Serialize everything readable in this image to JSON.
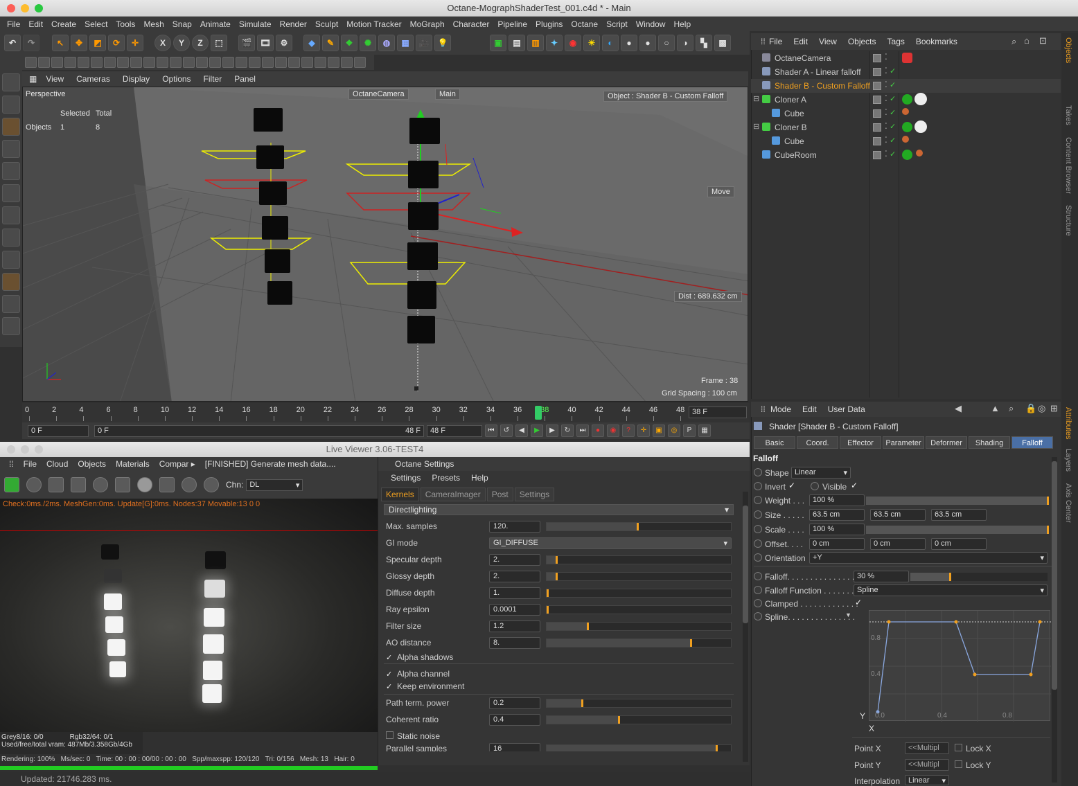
{
  "window": {
    "title": "Octane-MographShaderTest_001.c4d * - Main"
  },
  "menubar": [
    "File",
    "Edit",
    "Create",
    "Select",
    "Tools",
    "Mesh",
    "Snap",
    "Animate",
    "Simulate",
    "Render",
    "Sculpt",
    "Motion Tracker",
    "MoGraph",
    "Character",
    "Pipeline",
    "Plugins",
    "Octane",
    "Script",
    "Window",
    "Help"
  ],
  "toolbar": {
    "axis_x": "X",
    "axis_y": "Y",
    "axis_z": "Z"
  },
  "viewport": {
    "menu": [
      "View",
      "Cameras",
      "Display",
      "Options",
      "Filter",
      "Panel"
    ],
    "label": "Perspective",
    "selected_header": "Selected",
    "total_header": "Total",
    "objects_label": "Objects",
    "objects_selected": "1",
    "objects_total": "8",
    "camera_label": "OctaneCamera",
    "main_label": "Main",
    "object_info": "Object : Shader B - Custom Falloff",
    "move_label": "Move",
    "dist_label": "Dist : 689.632 cm",
    "frame_label": "Frame : 38",
    "grid_label": "Grid Spacing : 100 cm"
  },
  "timeline": {
    "ticks": [
      "0",
      "2",
      "4",
      "6",
      "8",
      "10",
      "12",
      "14",
      "16",
      "18",
      "20",
      "22",
      "24",
      "26",
      "28",
      "30",
      "32",
      "34",
      "36",
      "38",
      "40",
      "42",
      "44",
      "46",
      "48"
    ],
    "current_frame": "38",
    "end_field": "38 F",
    "start_field": "0 F",
    "range_start": "0 F",
    "range_end": "48 F",
    "max_field": "48 F"
  },
  "liveviewer": {
    "title": "Live Viewer 3.06-TEST4",
    "menu": [
      "File",
      "Cloud",
      "Objects",
      "Materials",
      "Compar ▸",
      "[FINISHED] Generate mesh data...."
    ],
    "channel_label": "Chn:",
    "channel_value": "DL",
    "stats_line": "Check:0ms./2ms. MeshGen:0ms. Update[G]:0ms. Nodes:37 Movable:13  0 0",
    "grey": "Grey8/16: 0/0",
    "rgb": "Rgb32/64: 0/1",
    "vram": "Used/free/total vram: 487Mb/3.358Gb/4Gb",
    "rendering": "Rendering: 100%",
    "mssec": "Ms/sec: 0",
    "time": "Time: 00 : 00 : 00/00 : 00 : 00",
    "spp": "Spp/maxspp: 120/120",
    "tri": "Tri: 0/156",
    "mesh": "Mesh: 13",
    "hair": "Hair: 0",
    "render_progress": 1.0
  },
  "octane_settings": {
    "title": "Octane Settings",
    "menu": [
      "Settings",
      "Presets",
      "Help"
    ],
    "tabs": [
      "Kernels",
      "CameraImager",
      "Post",
      "Settings"
    ],
    "kernel": "Directlighting",
    "params": [
      {
        "label": "Max. samples",
        "value": "120.",
        "fill": 0.5
      },
      {
        "label": "GI mode",
        "value": "GI_DIFFUSE"
      },
      {
        "label": "Specular depth",
        "value": "2.",
        "fill": 0.06
      },
      {
        "label": "Glossy depth",
        "value": "2.",
        "fill": 0.06
      },
      {
        "label": "Diffuse depth",
        "value": "1.",
        "fill": 0.0
      },
      {
        "label": "Ray epsilon",
        "value": "0.0001",
        "fill": 0.0
      },
      {
        "label": "Filter size",
        "value": "1.2",
        "fill": 0.23
      },
      {
        "label": "AO distance",
        "value": "8.",
        "fill": 0.79
      }
    ],
    "alpha_shadows": "Alpha shadows",
    "alpha_channel": "Alpha channel",
    "keep_environment": "Keep environment",
    "params2": [
      {
        "label": "Path term. power",
        "value": "0.2",
        "fill": 0.2
      },
      {
        "label": "Coherent ratio",
        "value": "0.4",
        "fill": 0.4
      }
    ],
    "static_noise": "Static noise",
    "parallel_samples": "Parallel samples",
    "parallel_value": "16"
  },
  "object_manager": {
    "menu": [
      "File",
      "Edit",
      "View",
      "Objects",
      "Tags",
      "Bookmarks"
    ],
    "objects": [
      {
        "name": "OctaneCamera",
        "indent": 0
      },
      {
        "name": "Shader A - Linear falloff",
        "indent": 0
      },
      {
        "name": "Shader B - Custom Falloff",
        "indent": 0,
        "selected": true
      },
      {
        "name": "Cloner A",
        "indent": 0
      },
      {
        "name": "Cube",
        "indent": 1
      },
      {
        "name": "Cloner B",
        "indent": 0
      },
      {
        "name": "Cube",
        "indent": 1
      },
      {
        "name": "CubeRoom",
        "indent": 0
      }
    ]
  },
  "attributes": {
    "menu": [
      "Mode",
      "Edit",
      "User Data"
    ],
    "object_title": "Shader [Shader B - Custom Falloff]",
    "tabs": [
      "Basic",
      "Coord.",
      "Effector",
      "Parameter",
      "Deformer",
      "Shading",
      "Falloff"
    ],
    "section": "Falloff",
    "shape_label": "Shape",
    "shape_value": "Linear",
    "invert_label": "Invert",
    "visible_label": "Visible",
    "weight_label": "Weight . . .",
    "weight_value": "100 %",
    "size_label": "Size . . . . .",
    "size_x": "63.5 cm",
    "size_y": "63.5 cm",
    "size_z": "63.5 cm",
    "scale_label": "Scale . . . .",
    "scale_value": "100 %",
    "offset_label": "Offset. . . .",
    "offset_x": "0 cm",
    "offset_y": "0 cm",
    "offset_z": "0 cm",
    "orientation_label": "Orientation",
    "orientation_value": "+Y",
    "falloff_label": "Falloff. . . . . . . . . . . . . . .",
    "falloff_value": "30 %",
    "falloff_fill": 0.3,
    "falloff_function_label": "Falloff Function . . . . . . .",
    "falloff_function_value": "Spline",
    "clamped_label": "Clamped . . . . . . . . . . . . .",
    "spline_label": "Spline. . . . . . . . . . . . . . .",
    "spline_y_axis": "Y",
    "spline_x_axis": "X",
    "spline_ticks_y": [
      "0.8",
      "0.4",
      "0.0"
    ],
    "spline_ticks_x": [
      "0.4",
      "0.8"
    ],
    "point_x_label": "Point X",
    "point_y_label": "Point Y",
    "point_value": "<<Multipl",
    "lock_x": "Lock X",
    "lock_y": "Lock Y",
    "interpolation_label": "Interpolation",
    "interpolation_value": "Linear"
  },
  "side_tabs": [
    "Objects",
    "Takes",
    "Content Browser",
    "Structure",
    "Attributes",
    "Layers",
    "Axis Center"
  ],
  "statusbar": "Updated: 21746.283 ms."
}
